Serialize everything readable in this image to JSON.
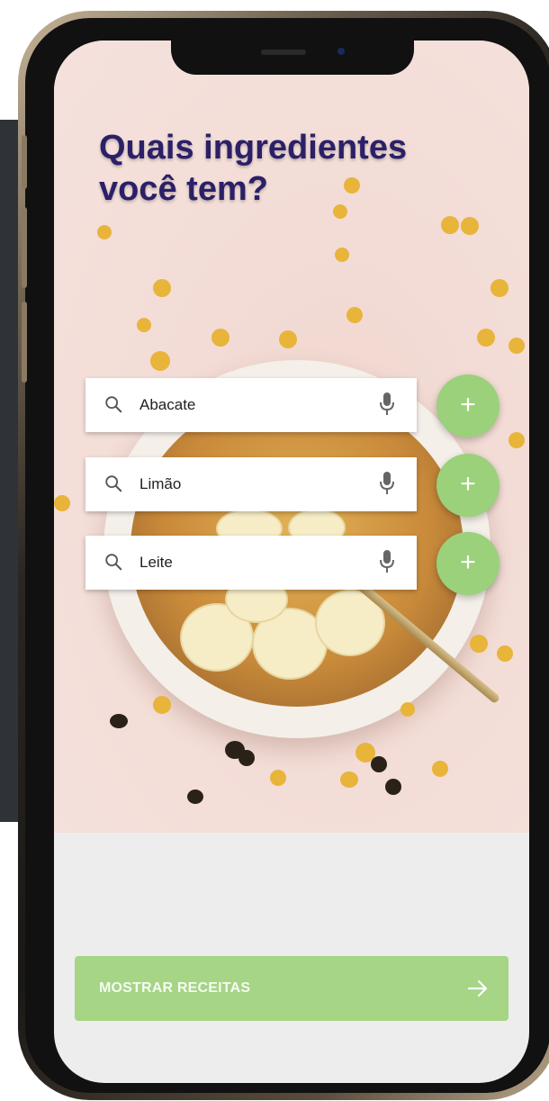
{
  "page": {
    "title": "Quais ingredientes você tem?"
  },
  "ingredients": [
    {
      "value": "Abacate"
    },
    {
      "value": "Limão"
    },
    {
      "value": "Leite"
    }
  ],
  "cta": {
    "label": "MOSTRAR RECEITAS",
    "arrow_icon": "arrow-right-icon"
  },
  "icons": {
    "search": "search-icon",
    "mic": "microphone-icon",
    "add": "plus-icon"
  },
  "colors": {
    "title": "#2b2068",
    "accent_green": "#9bd17a",
    "cta_green": "#a5d585",
    "screen_background": "#ededed",
    "hero_background": "#f3dcd6"
  }
}
